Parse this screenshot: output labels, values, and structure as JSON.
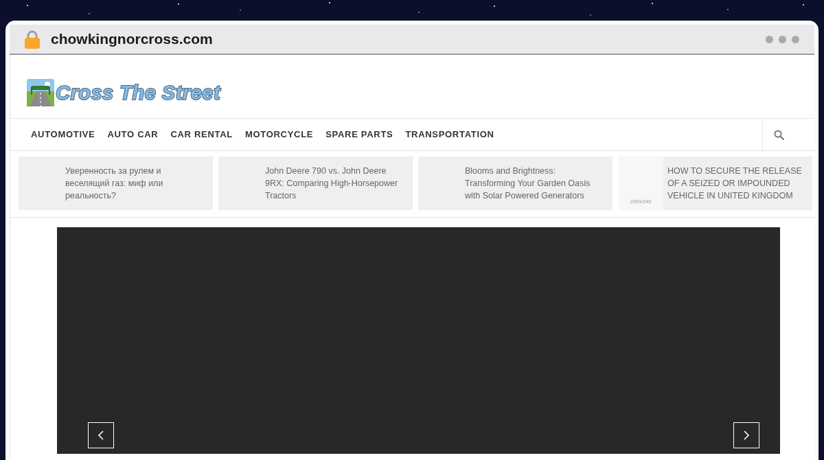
{
  "browser": {
    "url": "chowkingnorcross.com"
  },
  "site": {
    "logo_text": "Cross The Street"
  },
  "nav": [
    "AUTOMOTIVE",
    "AUTO CAR",
    "CAR RENTAL",
    "MOTORCYCLE",
    "SPARE PARTS",
    "TRANSPORTATION"
  ],
  "ticker": [
    {
      "title": "Уверенность за рулем и веселящий газ: миф или реальность?"
    },
    {
      "title": "John Deere 790 vs. John Deere 9RX: Comparing High-Horsepower Tractors"
    },
    {
      "title": "Blooms and Brightness: Transforming Your Garden Oasis with Solar Powered Generators"
    },
    {
      "title": "HOW TO SECURE THE RELEASE OF A SEIZED OR IMPOUNDED VEHICLE IN UNITED KINGDOM",
      "thumbnail_label": "240x240"
    }
  ]
}
